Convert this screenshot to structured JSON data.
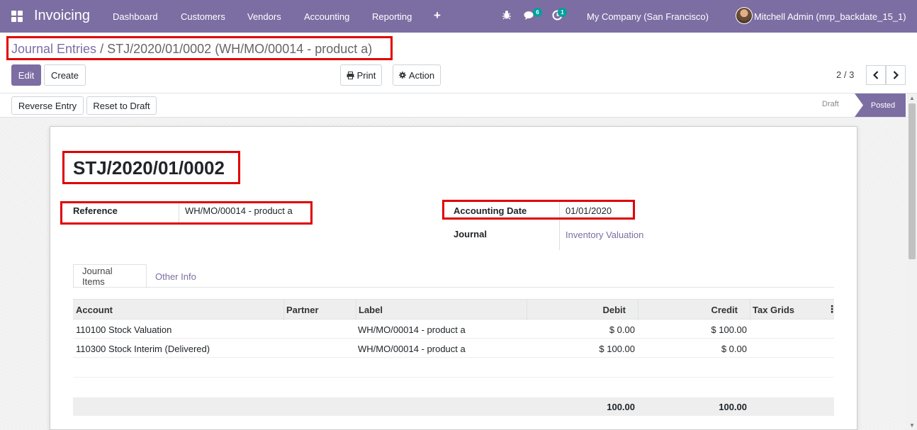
{
  "navbar": {
    "app_name": "Invoicing",
    "menu": [
      "Dashboard",
      "Customers",
      "Vendors",
      "Accounting",
      "Reporting"
    ],
    "plus_label": "+",
    "chat_badge": "6",
    "activity_badge": "1",
    "company": "My Company (San Francisco)",
    "user": "Mitchell Admin (mrp_backdate_15_1)"
  },
  "breadcrumb": {
    "parent": "Journal Entries",
    "separator": " / ",
    "current": "STJ/2020/01/0002 (WH/MO/00014 - product a)"
  },
  "buttons": {
    "edit": "Edit",
    "create": "Create",
    "print": "Print",
    "action": "Action",
    "reverse_entry": "Reverse Entry",
    "reset_to_draft": "Reset to Draft"
  },
  "pager": {
    "value": "2 / 3"
  },
  "status": {
    "draft": "Draft",
    "posted": "Posted",
    "current": "Posted"
  },
  "form": {
    "name": "STJ/2020/01/0002",
    "reference_label": "Reference",
    "reference_value": "WH/MO/00014 - product a",
    "accounting_date_label": "Accounting Date",
    "accounting_date_value": "01/01/2020",
    "journal_label": "Journal",
    "journal_value": "Inventory Valuation"
  },
  "tabs": [
    {
      "label": "Journal Items",
      "active": true
    },
    {
      "label": "Other Info",
      "active": false
    }
  ],
  "table": {
    "columns": [
      "Account",
      "Partner",
      "Label",
      "Debit",
      "Credit",
      "Tax Grids"
    ],
    "rows": [
      {
        "account": "110100 Stock Valuation",
        "partner": "",
        "label": "WH/MO/00014 - product a",
        "debit": "$ 0.00",
        "credit": "$ 100.00",
        "tax_grids": ""
      },
      {
        "account": "110300 Stock Interim (Delivered)",
        "partner": "",
        "label": "WH/MO/00014 - product a",
        "debit": "$ 100.00",
        "credit": "$ 0.00",
        "tax_grids": ""
      }
    ],
    "totals": {
      "debit": "100.00",
      "credit": "100.00"
    }
  },
  "colors": {
    "primary": "#7c6ea3",
    "badge": "#00a09d",
    "highlight": "#e00000"
  }
}
